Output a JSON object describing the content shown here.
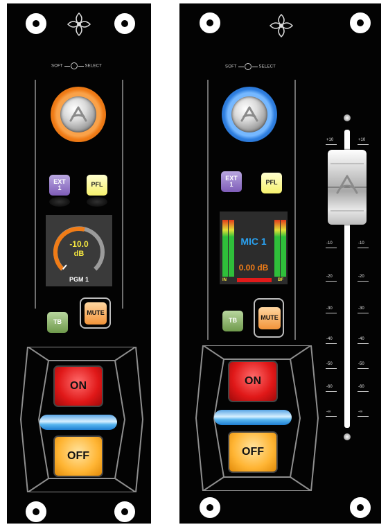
{
  "strip1": {
    "soft_label": "SOFT",
    "select_label": "SELECT",
    "ext_label": "EXT",
    "ext_num": "1",
    "pfl_label": "PFL",
    "gain_value": "-10.0",
    "gain_unit": "dB",
    "source_name": "PGM 1",
    "tb_label": "TB",
    "mute_label": "MUTE",
    "on_label": "ON",
    "off_label": "OFF",
    "gain_fraction": 0.55
  },
  "strip2": {
    "soft_label": "SOFT",
    "select_label": "SELECT",
    "ext_label": "EXT",
    "ext_num": "1",
    "pfl_label": "PFL",
    "channel_name": "MIC 1",
    "level_value": "0.00 dB",
    "meter_in_label": "IN",
    "meter_bf_label": "BF",
    "tb_label": "TB",
    "mute_label": "MUTE",
    "on_label": "ON",
    "off_label": "OFF"
  },
  "fader": {
    "scale_labels": [
      "+10",
      "-10",
      "-20",
      "-30",
      "-40",
      "-50",
      "-60",
      "-∞"
    ],
    "level_db": 0
  },
  "colors": {
    "knob1_ring": "#f07c17",
    "knob2_ring": "#2f7fe0",
    "gain_arc": "#f07c17",
    "display_text_yellow": "#f4e640",
    "channel_name_blue": "#2aa0ee",
    "level_value_orange": "#f07c17",
    "meter_green": "#2fbf3a",
    "mute_orange": "#f2943a",
    "on_red": "#e01818",
    "off_orange": "#ffb534"
  }
}
